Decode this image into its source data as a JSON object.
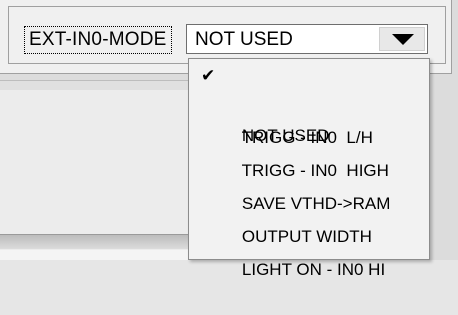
{
  "mode_field": {
    "label": "EXT-IN0-MODE",
    "selected_value": "NOT USED"
  },
  "dropdown": {
    "options": [
      {
        "label": "NOT USED",
        "checked": true
      },
      {
        "label": "TRIGG - IN0  L/H",
        "checked": false
      },
      {
        "label": "TRIGG - IN0  HIGH",
        "checked": false
      },
      {
        "label": "SAVE VTHD->RAM",
        "checked": false
      },
      {
        "label": "OUTPUT WIDTH",
        "checked": false
      },
      {
        "label": "LIGHT ON - IN0 HI",
        "checked": false
      }
    ],
    "check_glyph": "✔"
  },
  "icons": {
    "dropdown_arrow": "chevron-down-icon",
    "check": "checkmark-icon"
  },
  "colors": {
    "panel_bg": "#f0f0f0",
    "list_bg": "#f2f2f2",
    "field_bg": "#ffffff",
    "text": "#000000"
  }
}
